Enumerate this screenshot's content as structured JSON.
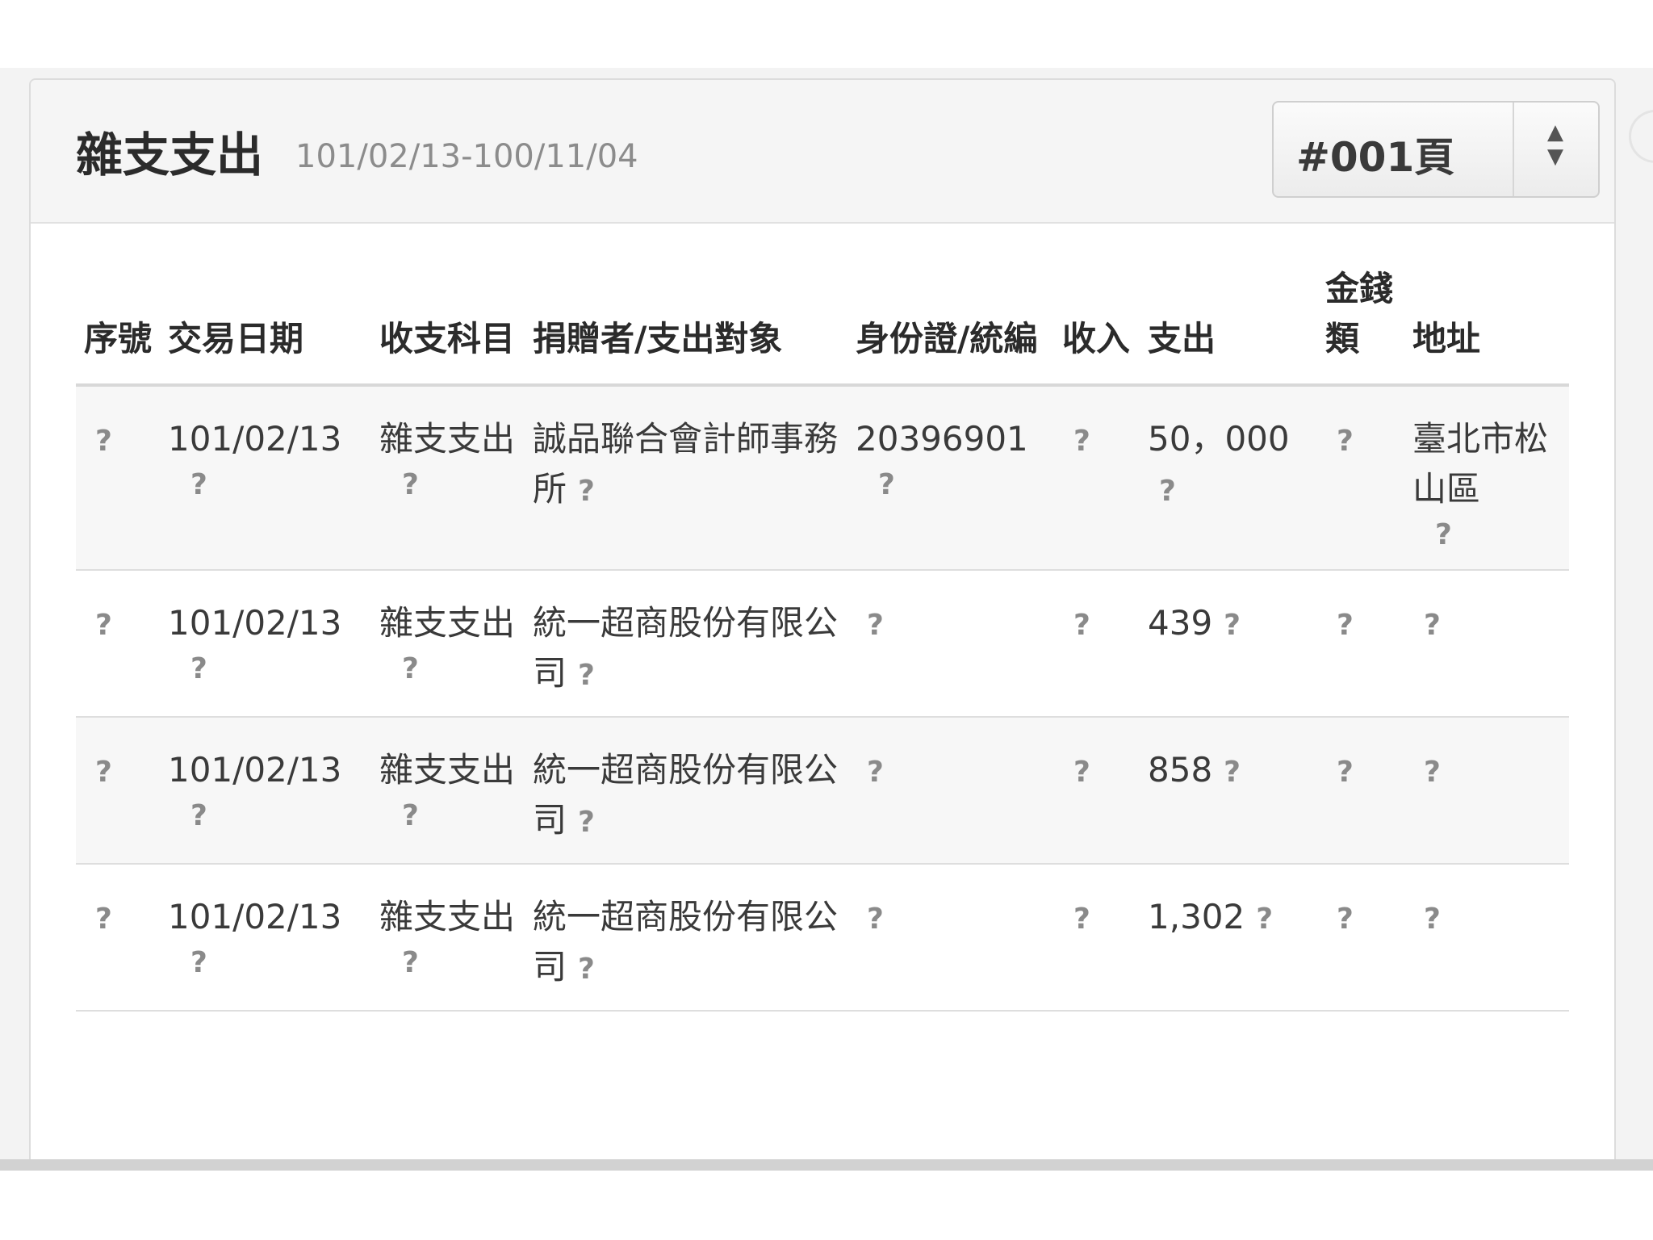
{
  "panel": {
    "title": "雜支支出",
    "date_range": "101/02/13-100/11/04"
  },
  "page_select": {
    "value": "#001頁",
    "arrows": "▲▼"
  },
  "table": {
    "headers": {
      "seq": "序號",
      "date": "交易日期",
      "category": "收支科目",
      "party": "捐贈者/支出對象",
      "id_number": "身份證/統編",
      "income": "收入",
      "expense": "支出",
      "money_type": "金錢類",
      "address": "地址"
    },
    "help_glyph": "?",
    "rows": [
      {
        "date": "101/02/13",
        "category": "雜支支出",
        "party": "誠品聯合會計師事務所",
        "id_number": "20396901",
        "expense": "50，000",
        "address": "臺北市松山區"
      },
      {
        "date": "101/02/13",
        "category": "雜支支出",
        "party": "統一超商股份有限公司",
        "id_number": "",
        "expense": "439",
        "address": ""
      },
      {
        "date": "101/02/13",
        "category": "雜支支出",
        "party": "統一超商股份有限公司",
        "id_number": "",
        "expense": "858",
        "address": ""
      },
      {
        "date": "101/02/13",
        "category": "雜支支出",
        "party": "統一超商股份有限公司",
        "id_number": "",
        "expense": "1,302",
        "address": ""
      }
    ]
  }
}
